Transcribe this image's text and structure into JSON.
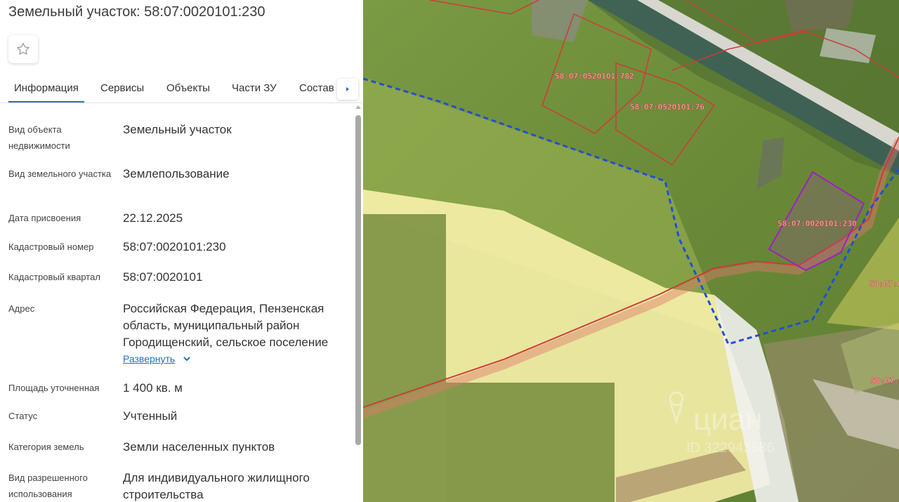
{
  "header": {
    "title": "Земельный участок: 58:07:0020101:230"
  },
  "tabs": [
    {
      "label": "Информация"
    },
    {
      "label": "Сервисы"
    },
    {
      "label": "Объекты"
    },
    {
      "label": "Части ЗУ"
    },
    {
      "label": "Состав"
    }
  ],
  "info": {
    "object_type": {
      "label": "Вид объекта недвижимости",
      "value": "Земельный участок"
    },
    "land_type": {
      "label": "Вид земельного участка",
      "value": "Землепользование"
    },
    "date": {
      "label": "Дата присвоения",
      "value": "22.12.2025"
    },
    "cadastral_number": {
      "label": "Кадастровый номер",
      "value": "58:07:0020101:230"
    },
    "cadastral_block": {
      "label": "Кадастровый квартал",
      "value": "58:07:0020101"
    },
    "address": {
      "label": "Адрес",
      "value": "Российская Федерация, Пензенская область, муниципальный район Городищенский, сельское поселение",
      "expand_label": "Развернуть"
    },
    "area": {
      "label": "Площадь уточненная",
      "value": "1 400 кв. м"
    },
    "status": {
      "label": "Статус",
      "value": "Учтенный"
    },
    "category": {
      "label": "Категория земель",
      "value": "Земли населенных пунктов"
    },
    "permitted_use": {
      "label": "Вид разрешенного использования",
      "value": "Для индивидуального жилищного строительства"
    }
  },
  "map": {
    "parcel_labels": [
      "58:07:0520101:782",
      "58:07:0520101:76",
      "58:07:0020101:230",
      "58:07:0",
      "58:07:0"
    ],
    "watermark_brand": "циан",
    "watermark_id": "ID 322943586",
    "colors": {
      "grass": "#6f8f3c",
      "highlight_parcel": "#a020c0",
      "boundary_red": "#d13a3a",
      "block_boundary": "#1f4fd8",
      "overlay_yellow": "#fff6b0"
    }
  }
}
